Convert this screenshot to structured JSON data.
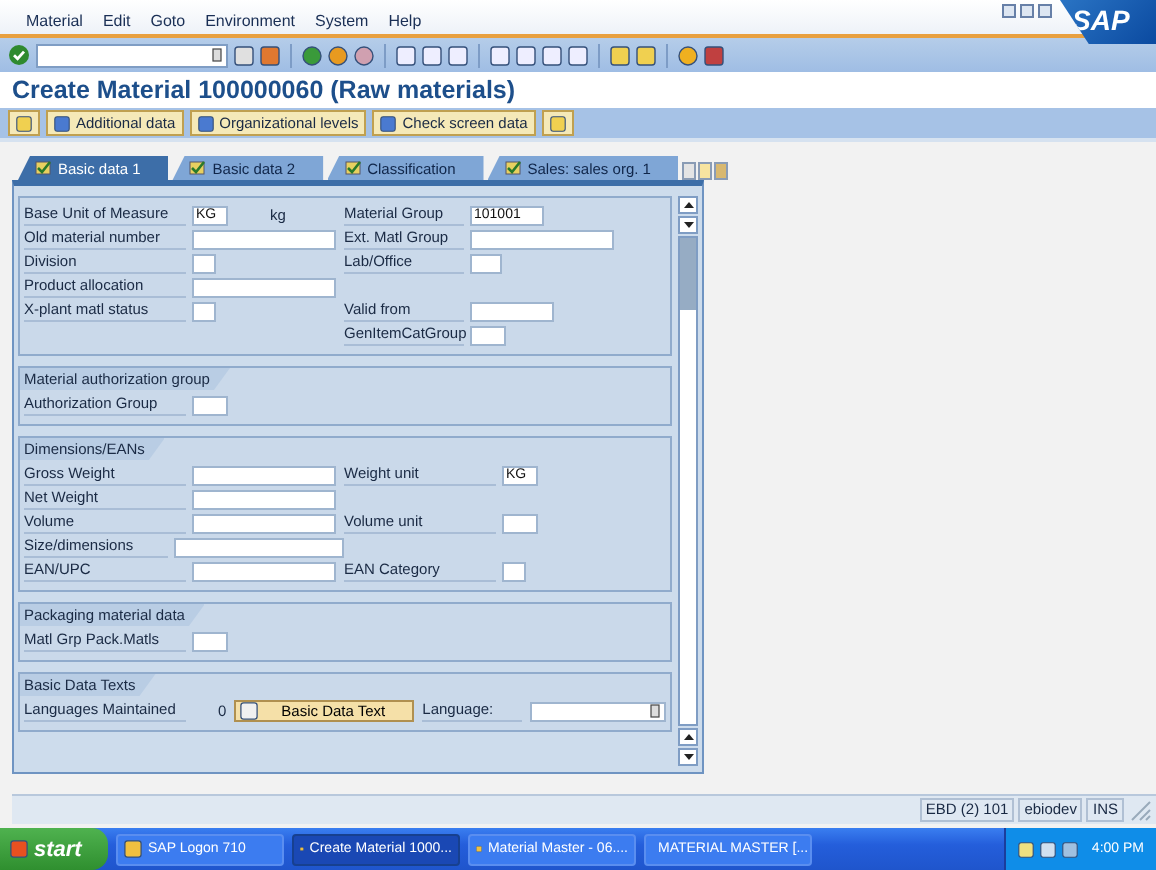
{
  "menu": [
    "Material",
    "Edit",
    "Goto",
    "Environment",
    "System",
    "Help"
  ],
  "logo": "SAP",
  "title": "Create Material 100000060 (Raw materials)",
  "app_toolbar": [
    {
      "kind": "icon"
    },
    {
      "kind": "text",
      "label": "Additional data"
    },
    {
      "kind": "text",
      "label": "Organizational levels"
    },
    {
      "kind": "text",
      "label": "Check screen data"
    },
    {
      "kind": "icon"
    }
  ],
  "tabs": [
    {
      "label": "Basic data 1",
      "selected": true
    },
    {
      "label": "Basic data 2",
      "selected": false
    },
    {
      "label": "Classification",
      "selected": false
    },
    {
      "label": "Sales: sales org. 1",
      "selected": false
    }
  ],
  "sections": [
    {
      "rows": [
        {
          "left": {
            "label": "Base Unit of Measure",
            "value": "KG",
            "unit": "kg"
          },
          "right": {
            "label": "Material Group",
            "value": "101001"
          }
        },
        {
          "left": {
            "label": "Old material number"
          },
          "right": {
            "label": "Ext. Matl Group"
          }
        },
        {
          "left": {
            "label": "Division"
          },
          "right": {
            "label": "Lab/Office"
          }
        },
        {
          "left": {
            "label": "Product allocation"
          }
        },
        {
          "left": {
            "label": "X-plant matl status"
          },
          "right": {
            "label": "Valid from"
          }
        },
        {
          "right": {
            "label": "GenItemCatGroup"
          }
        }
      ]
    },
    {
      "title": "Material authorization group",
      "rows": [
        {
          "left": {
            "label": "Authorization Group"
          }
        }
      ]
    },
    {
      "title": "Dimensions/EANs",
      "rows": [
        {
          "left": {
            "label": "Gross Weight"
          },
          "right": {
            "label": "Weight unit",
            "value": "KG"
          }
        },
        {
          "left": {
            "label": "Net Weight"
          }
        },
        {
          "left": {
            "label": "Volume"
          },
          "right": {
            "label": "Volume unit"
          }
        },
        {
          "left": {
            "label": "Size/dimensions"
          }
        },
        {
          "left": {
            "label": "EAN/UPC"
          },
          "right": {
            "label": "EAN Category"
          }
        }
      ]
    },
    {
      "title": "Packaging material data",
      "rows": [
        {
          "left": {
            "label": "Matl Grp Pack.Matls"
          }
        }
      ]
    }
  ],
  "texts_section": {
    "title": "Basic Data Texts",
    "label": "Languages Maintained",
    "count": "0",
    "button": "Basic Data Text",
    "language_label": "Language:"
  },
  "status_bar": [
    "EBD (2) 101",
    "ebiodev",
    "INS"
  ],
  "taskbar": {
    "start": "start",
    "items": [
      {
        "label": "SAP Logon 710",
        "selected": false
      },
      {
        "label": "Create Material 1000...",
        "selected": true
      },
      {
        "label": "Material Master - 06....",
        "selected": false
      },
      {
        "label": "MATERIAL MASTER [...",
        "selected": false
      }
    ],
    "clock": "4:00 PM"
  }
}
